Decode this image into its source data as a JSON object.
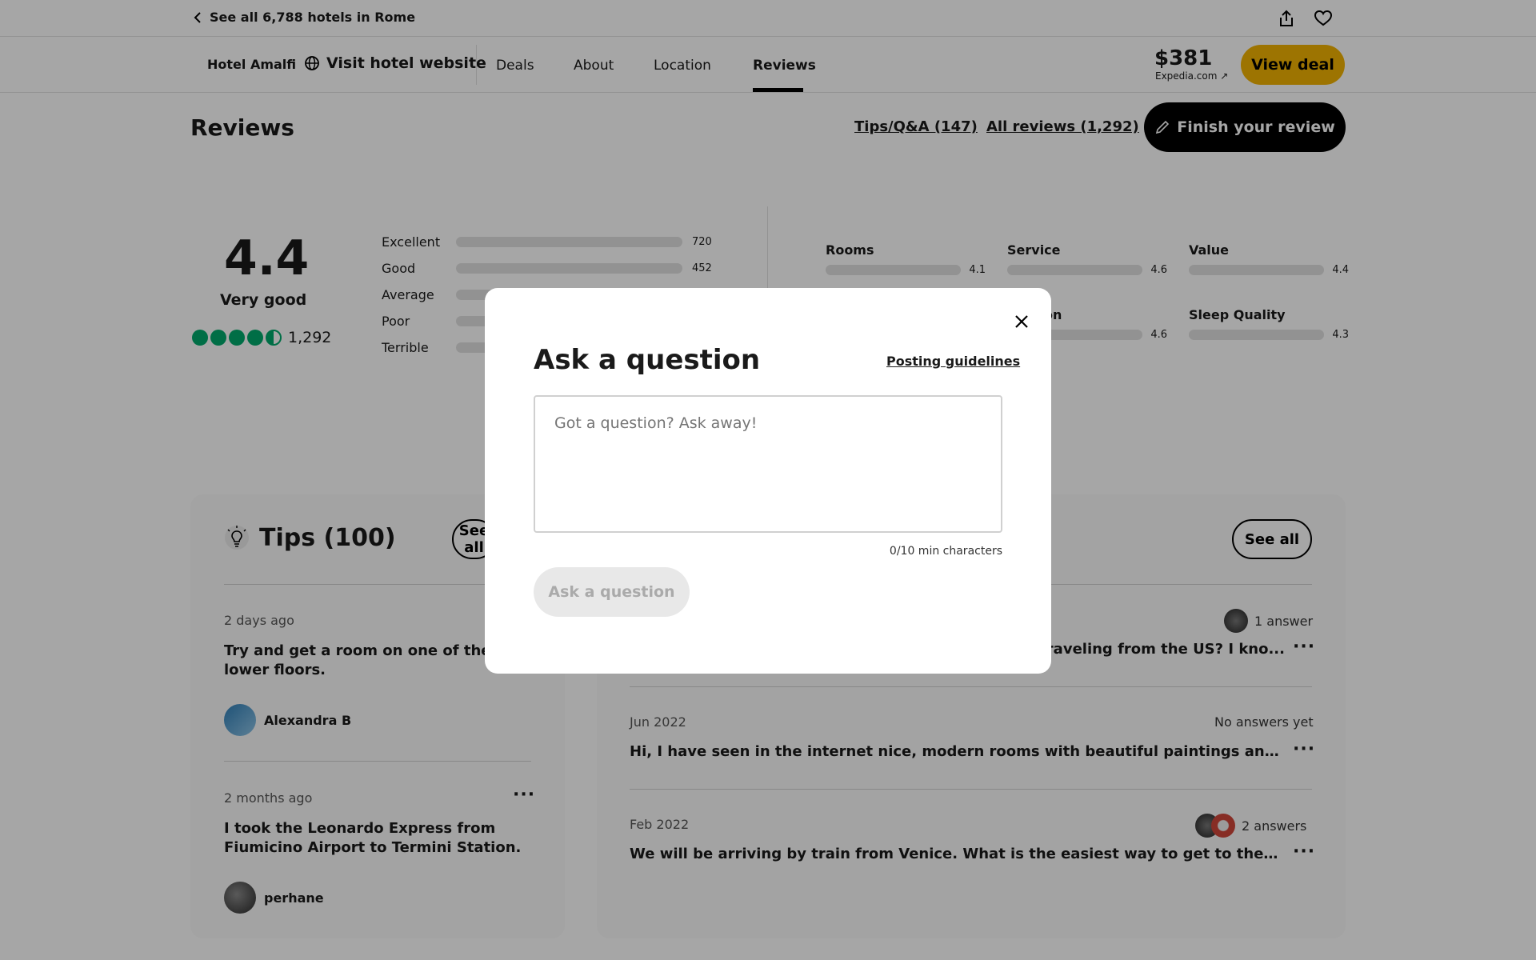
{
  "topbar": {
    "back_label": "See all 6,788 hotels in Rome"
  },
  "subnav": {
    "hotel_name": "Hotel Amalfi",
    "visit_label": "Visit hotel website",
    "tabs": [
      {
        "label": "Deals"
      },
      {
        "label": "About"
      },
      {
        "label": "Location"
      },
      {
        "label": "Reviews"
      }
    ],
    "price": "$381",
    "price_source": "Expedia.com ↗",
    "view_deal": "View deal"
  },
  "reviews": {
    "title": "Reviews",
    "tips_link": "Tips/Q&A (147)",
    "all_reviews_link": "All reviews (1,292)",
    "finish_review": "Finish your review",
    "score": "4.4",
    "score_label": "Very good",
    "count": "1,292",
    "distribution": [
      {
        "label": "Excellent",
        "count": "720",
        "fraction": 1.0
      },
      {
        "label": "Good",
        "count": "452",
        "fraction": 0.63
      },
      {
        "label": "Average",
        "count": "",
        "fraction": 0.14
      },
      {
        "label": "Poor",
        "count": "",
        "fraction": 0.05
      },
      {
        "label": "Terrible",
        "count": "",
        "fraction": 0.05
      }
    ],
    "sub_ratings": [
      {
        "label": "Rooms",
        "value": "4.1",
        "fraction": 0.82
      },
      {
        "label": "Service",
        "value": "4.6",
        "fraction": 0.92
      },
      {
        "label": "Value",
        "value": "4.4",
        "fraction": 0.88
      },
      {
        "label": "on",
        "value": "4.6",
        "fraction": 0.92
      },
      {
        "label": "Sleep Quality",
        "value": "4.3",
        "fraction": 0.86
      }
    ]
  },
  "tips": {
    "title": "Tips (100)",
    "see_all": "See all",
    "items": [
      {
        "meta": "2 days ago",
        "text": "Try and get a room on one of the lower floors.",
        "user": "Alexandra B"
      },
      {
        "meta": "2 months ago",
        "text": "I took the Leonardo Express from Fiumicino Airport to Termini Station. Fro...",
        "user": "perhane"
      }
    ]
  },
  "qa": {
    "see_all": "See all",
    "items": [
      {
        "meta": "",
        "text": "traveling from the US? I kno...",
        "answers": "1 answer"
      },
      {
        "meta": "Jun 2022",
        "text": "Hi, I have seen in the internet nice, modern rooms with beautiful paintings and also old...",
        "answers": "No answers yet"
      },
      {
        "meta": "Feb 2022",
        "text": "We will be arriving by train from Venice. What is the easiest way to get to the hotel fro...",
        "answers": "2 answers"
      }
    ]
  },
  "modal": {
    "title": "Ask a question",
    "guidelines": "Posting guidelines",
    "placeholder": "Got a question? Ask away!",
    "char_count": "0/10 min characters",
    "submit": "Ask a question"
  },
  "colors": {
    "accent_green": "#00aa6c",
    "deal_yellow": "#f2b203"
  }
}
